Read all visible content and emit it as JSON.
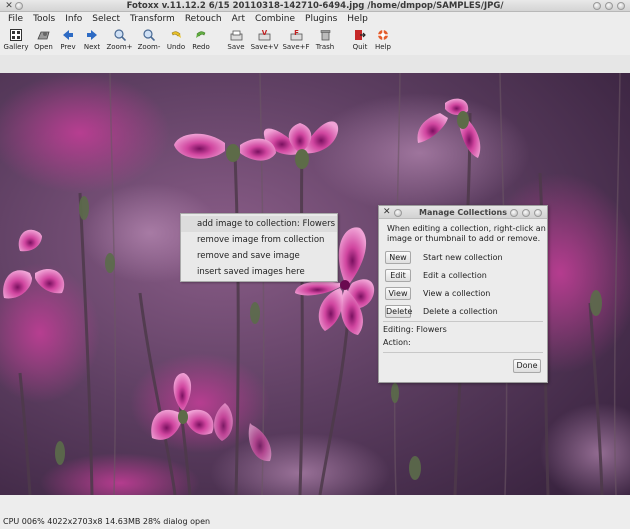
{
  "window": {
    "title": "Fotoxx v.11.12.2  6/15  20110318-142710-6494.jpg  /home/dmpop/SAMPLES/JPG/"
  },
  "menubar": [
    "File",
    "Tools",
    "Info",
    "Select",
    "Transform",
    "Retouch",
    "Art",
    "Combine",
    "Plugins",
    "Help"
  ],
  "toolbar": [
    {
      "label": "Gallery",
      "icon": "gallery-icon"
    },
    {
      "label": "Open",
      "icon": "open-icon"
    },
    {
      "label": "Prev",
      "icon": "prev-arrow-icon"
    },
    {
      "label": "Next",
      "icon": "next-arrow-icon"
    },
    {
      "label": "Zoom+",
      "icon": "zoom-in-icon"
    },
    {
      "label": "Zoom-",
      "icon": "zoom-out-icon"
    },
    {
      "label": "Undo",
      "icon": "undo-icon"
    },
    {
      "label": "Redo",
      "icon": "redo-icon"
    },
    {
      "label": "Save",
      "icon": "save-icon"
    },
    {
      "label": "Save+V",
      "icon": "save-version-icon"
    },
    {
      "label": "Save+F",
      "icon": "save-file-icon"
    },
    {
      "label": "Trash",
      "icon": "trash-icon"
    },
    {
      "label": "Quit",
      "icon": "quit-icon"
    },
    {
      "label": "Help",
      "icon": "help-icon"
    }
  ],
  "popup_menu": {
    "items": [
      "add image to collection: Flowers",
      "remove image from collection",
      "remove and save image",
      "insert saved images here"
    ]
  },
  "dialog": {
    "title": "Manage Collections",
    "help": "When editing a collection, right-click an image or thumbnail to add or remove.",
    "actions": [
      {
        "button": "New",
        "description": "Start new collection"
      },
      {
        "button": "Edit",
        "description": "Edit a collection"
      },
      {
        "button": "View",
        "description": "View a collection"
      },
      {
        "button": "Delete",
        "description": "Delete a collection"
      }
    ],
    "editing_label": "Editing:",
    "editing_value": "Flowers",
    "action_label": "Action:",
    "done_label": "Done"
  },
  "statusbar": {
    "text": "CPU 006%  4022x2703x8 14.63MB 28%  dialog open"
  },
  "colors": {
    "photo_magenta": "#c8409c",
    "photo_background": "#5a3a60"
  }
}
